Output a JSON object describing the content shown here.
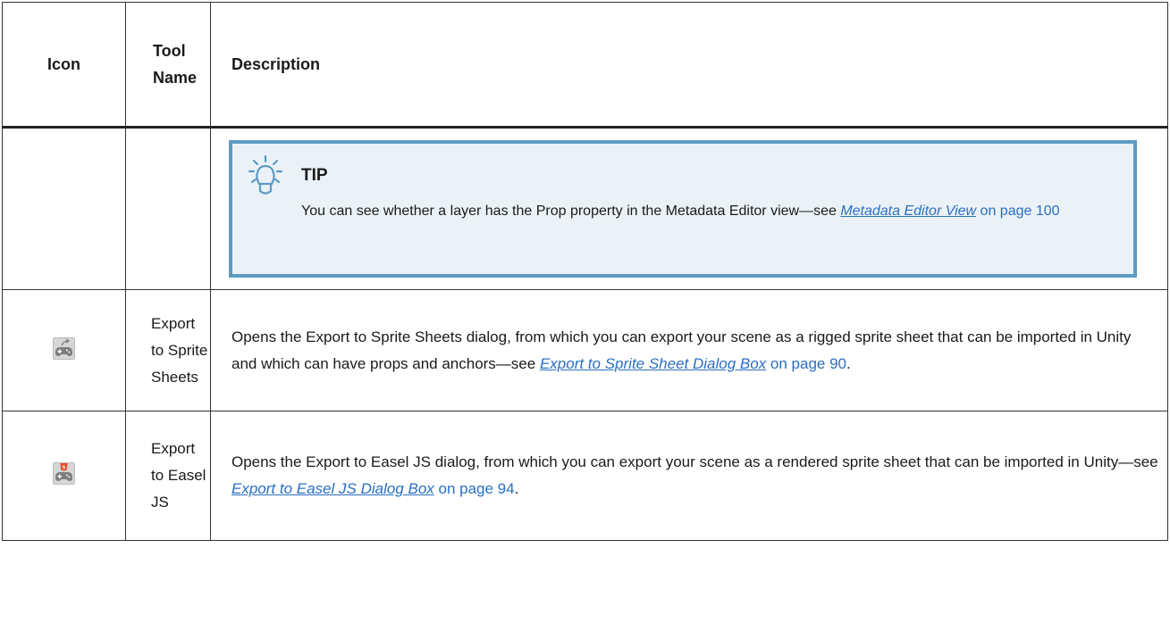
{
  "table": {
    "headers": {
      "icon": "Icon",
      "tool_name_line1": "Tool",
      "tool_name_line2": "Name",
      "description": "Description"
    },
    "tip": {
      "title": "TIP",
      "text": "You can see whether a layer has the Prop property in the Metadata Editor view—see ",
      "link_text": "Metadata Editor View",
      "page_text": " on page 100"
    },
    "rows": [
      {
        "icon_name": "export-sprite-sheets-icon",
        "tool_name_lines": [
          "Export",
          "to Sprite",
          "Sheets"
        ],
        "description_text": "Opens the Export to Sprite Sheets dialog, from which you can export your scene as a rigged sprite sheet that can be imported in Unity and which can have props and anchors—see ",
        "link_text": "Export to Sprite Sheet Dialog Box",
        "page_text": " on page 90",
        "end": "."
      },
      {
        "icon_name": "export-easeljs-icon",
        "tool_name_lines": [
          "Export",
          "to Easel",
          "JS"
        ],
        "description_text": "Opens the Export to Easel JS dialog, from which you can export your scene as a rendered sprite sheet that can be imported in Unity—see ",
        "link_text": "Export to Easel JS Dialog Box",
        "page_text": " on page 94",
        "end": "."
      }
    ]
  },
  "colors": {
    "tip_border": "#5c9bc4",
    "tip_background": "#ebf2f7",
    "link": "#2a6fc0"
  }
}
